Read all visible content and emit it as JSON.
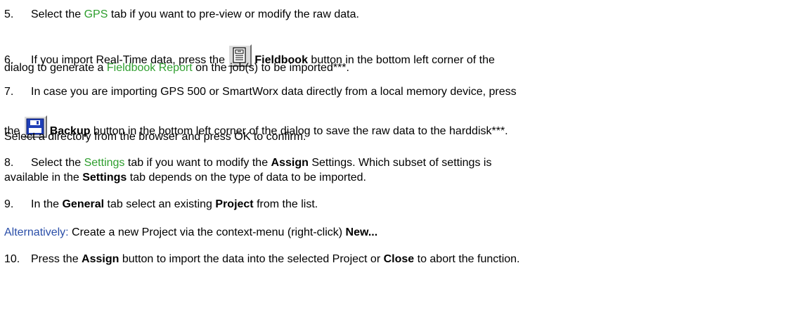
{
  "steps": {
    "s5": {
      "num": "5.",
      "t1": "Select the ",
      "link": "GPS",
      "t2": " tab if you want to pre-view or modify the raw data."
    },
    "s6": {
      "num": "6.",
      "t1": "If you import Real-Time data, press the ",
      "bold": "Fieldbook",
      "t2": " button in the bottom left corner of the",
      "t3": "dialog to generate a ",
      "link": "Fieldbook Report",
      "t4": " on the job(s) to be imported***."
    },
    "s7": {
      "num": "7.",
      "t1": "In case you are importing GPS 500 or SmartWorx data directly from a local memory device, press",
      "t2": "the ",
      "bold": "Backup",
      "t3": " button in the bottom left corner of the dialog to save the raw data to the harddisk***.",
      "t4": "Select a directory from the browser and press OK to confirm."
    },
    "s8": {
      "num": "8.",
      "t1": "Select the ",
      "link": "Settings",
      "t2": " tab if you want to modify the ",
      "b1": "Assign",
      "t3": " Settings. Which subset of settings is",
      "t4": "available in the ",
      "b2": "Settings",
      "t5": " tab depends on the type of data to be imported."
    },
    "s9": {
      "num": "9.",
      "t1": "In the ",
      "b1": "General",
      "t2": " tab select an existing ",
      "b2": "Project",
      "t3": " from the list."
    },
    "alt": {
      "label": "Alternatively:",
      "t1": " Create a new Project via the context-menu (right-click) ",
      "bold": "New..."
    },
    "s10": {
      "num": "10.",
      "t1": "Press the ",
      "b1": "Assign",
      "t2": " button to import the data into the selected Project or ",
      "b2": "Close",
      "t3": " to abort the function."
    }
  },
  "icons": {
    "fieldbook": "fieldbook-icon",
    "backup": "floppy-disk-icon"
  },
  "colors": {
    "link": "#2e9e2e",
    "alt": "#2a4ea8",
    "icon_blue": "#1f3fb8"
  }
}
